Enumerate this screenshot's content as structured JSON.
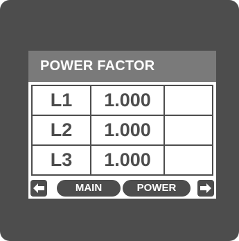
{
  "screen": {
    "title": "POWER FACTOR"
  },
  "rows": [
    {
      "phase": "L1",
      "value": "1.000"
    },
    {
      "phase": "L2",
      "value": "1.000"
    },
    {
      "phase": "L3",
      "value": "1.000"
    }
  ],
  "nav": {
    "left_icon": "arrow-left-icon",
    "right_icon": "arrow-right-icon",
    "main_label": "MAIN",
    "power_label": "POWER"
  },
  "colors": {
    "bezel": "#4d4d4d",
    "title_bar": "#7a7a7a",
    "screen": "#ffffff",
    "text": "#4d4d4d"
  }
}
